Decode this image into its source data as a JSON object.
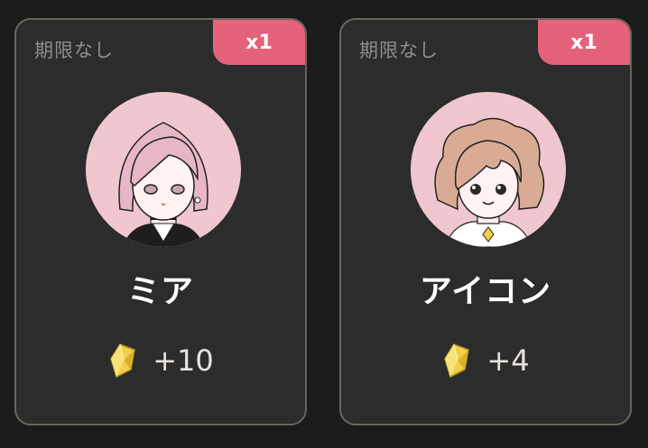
{
  "cards": [
    {
      "expiry": "期限なし",
      "badge": "x1",
      "name": "ミア",
      "reward": "+10",
      "avatar_bg": "#f0c7cf",
      "hair_color": "#e7b7c7",
      "icon": "gem-icon"
    },
    {
      "expiry": "期限なし",
      "badge": "x1",
      "name": "アイコン",
      "reward": "+4",
      "avatar_bg": "#f0c7cf",
      "hair_color": "#d9ab95",
      "icon": "gem-icon"
    }
  ],
  "colors": {
    "badge": "#e4627a",
    "card_bg": "#2c2c2c",
    "card_border": "#6b6459",
    "gem": "#f1cf4a"
  }
}
